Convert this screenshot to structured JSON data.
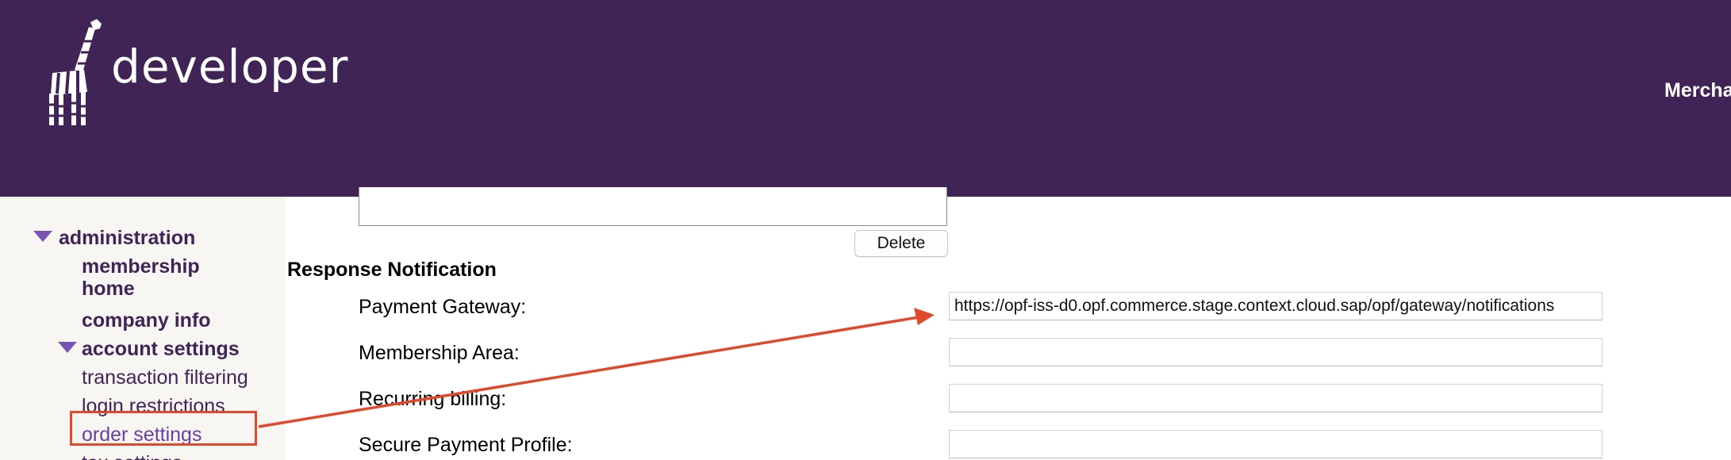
{
  "header": {
    "logo_text": "developer",
    "merchant_link": "Merchant"
  },
  "sidebar": {
    "items": [
      {
        "label": "administration"
      },
      {
        "label": "membership home"
      },
      {
        "label": "company info"
      },
      {
        "label": "account settings"
      },
      {
        "label": "transaction filtering"
      },
      {
        "label": "login restrictions"
      },
      {
        "label": "order settings"
      },
      {
        "label": "tax settings"
      }
    ]
  },
  "main": {
    "delete_label": "Delete",
    "section_title": "Response Notification",
    "fields": [
      {
        "label": "Payment Gateway:",
        "value": "https://opf-iss-d0.opf.commerce.stage.context.cloud.sap/opf/gateway/notifications"
      },
      {
        "label": "Membership Area:",
        "value": ""
      },
      {
        "label": "Recurring billing:",
        "value": ""
      },
      {
        "label": "Secure Payment Profile:",
        "value": ""
      }
    ]
  },
  "colors": {
    "header_bg": "#3f2455",
    "sidebar_bg": "#f7f6f3",
    "annotation": "#e04a2c",
    "link": "#6b3fa0"
  }
}
